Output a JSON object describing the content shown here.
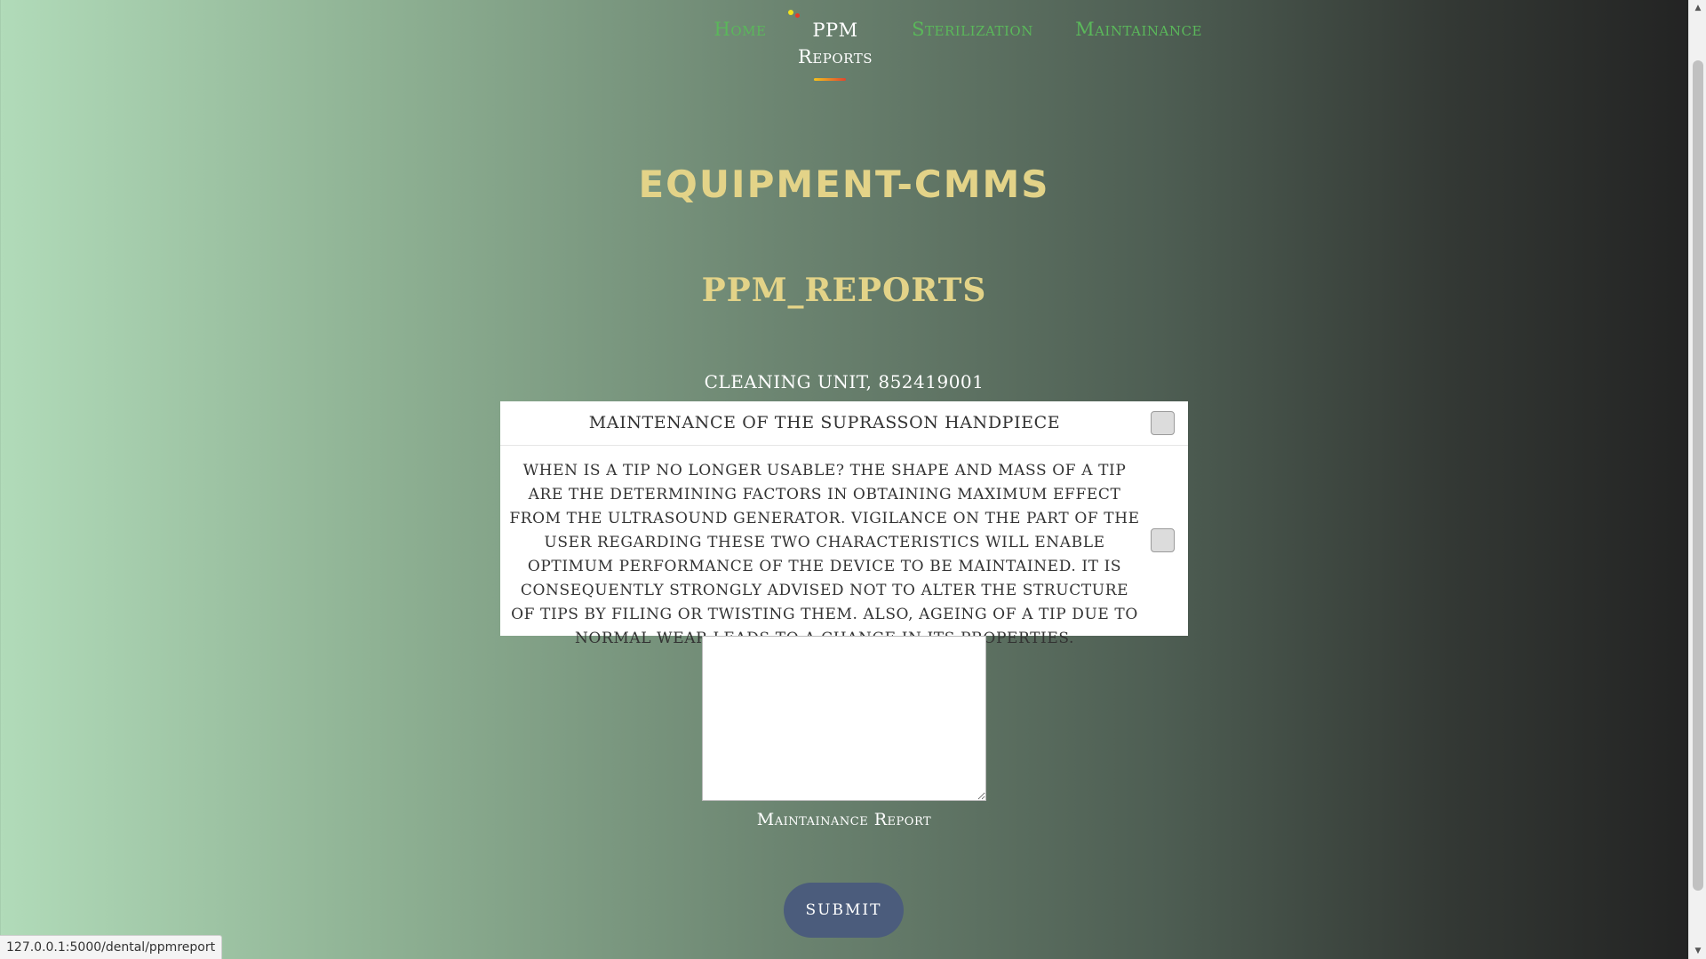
{
  "nav": {
    "items": [
      {
        "label": "Home"
      },
      {
        "label_line1": "PPM",
        "label_line2": "Reports"
      },
      {
        "label": "Sterilization"
      },
      {
        "label": "Maintainance"
      }
    ]
  },
  "brand": {
    "title": "EQUIPMENT-CMMS"
  },
  "page": {
    "title": "PPM_REPORTS"
  },
  "unit": {
    "title": "CLEANING UNIT, 852419001"
  },
  "checklist": {
    "items": [
      {
        "text": "MAINTENANCE OF THE SUPRASSON HANDPIECE",
        "checked": false
      },
      {
        "text": "WHEN IS A TIP NO LONGER USABLE? THE SHAPE AND MASS OF A TIP ARE THE DETERMINING FACTORS IN OBTAINING MAXIMUM EFFECT FROM THE ULTRASOUND GENERATOR. VIGILANCE ON THE PART OF THE USER REGARDING THESE TWO CHARACTERISTICS WILL ENABLE OPTIMUM PERFORMANCE OF THE DEVICE TO BE MAINTAINED. IT IS CONSEQUENTLY STRONGLY ADVISED NOT TO ALTER THE STRUCTURE OF TIPS BY FILING OR TWISTING THEM. ALSO, AGEING OF A TIP DUE TO NORMAL WEAR LEADS TO A CHANGE IN ITS PROPERTIES.",
        "checked": false
      }
    ]
  },
  "report": {
    "value": "",
    "label": "Maintainance Report"
  },
  "form": {
    "submit_label": "SUBMIT"
  },
  "status_bar": {
    "url": "127.0.0.1:5000/dental/ppmreport"
  },
  "colors": {
    "nav_link": "#5ab85a",
    "nav_active": "#ffffff",
    "heading_gold": "#e3d388",
    "submit_bg": "#4b5c7c",
    "gradient_start": "#b1dbb9",
    "gradient_end": "#222222"
  },
  "icons": {
    "scroll_up": "▲",
    "scroll_down": "▼"
  }
}
